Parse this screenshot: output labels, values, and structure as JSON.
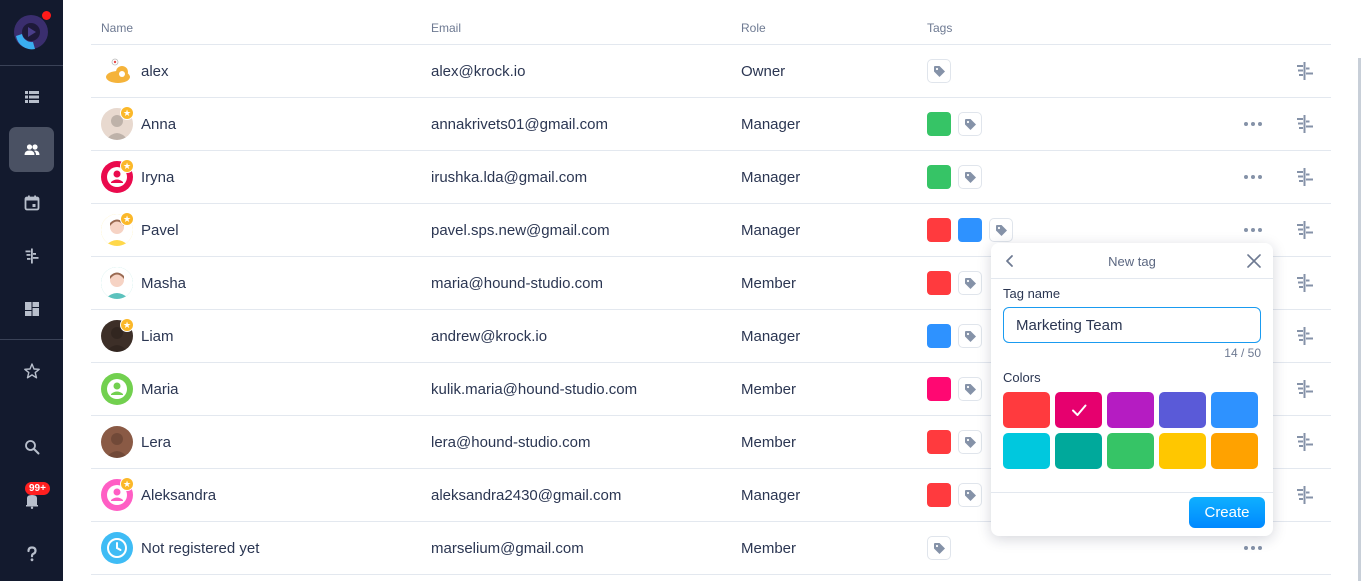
{
  "sidebar": {
    "items": [
      {
        "name": "list",
        "icon": "list-icon",
        "active": false
      },
      {
        "name": "team",
        "icon": "users-icon",
        "active": true
      },
      {
        "name": "calendar",
        "icon": "calendar-icon",
        "active": false
      },
      {
        "name": "timeline",
        "icon": "timeline-icon",
        "active": false
      },
      {
        "name": "dashboard",
        "icon": "dashboard-icon",
        "active": false
      },
      {
        "name": "favorites",
        "icon": "star-icon",
        "active": false
      },
      {
        "name": "search",
        "icon": "search-icon",
        "active": false
      },
      {
        "name": "notifications",
        "icon": "bell-icon",
        "active": false
      },
      {
        "name": "help",
        "icon": "help-icon",
        "active": false
      }
    ],
    "notification_badge": "99+"
  },
  "table": {
    "headers": {
      "name": "Name",
      "email": "Email",
      "role": "Role",
      "tags": "Tags"
    },
    "rows": [
      {
        "name": "alex",
        "email": "alex@krock.io",
        "role": "Owner",
        "tags": [],
        "star": false,
        "avatar": "dog-sticker",
        "avatar_color": "#f5b33a",
        "more": false
      },
      {
        "name": "Anna",
        "email": "annakrivets01@gmail.com",
        "role": "Manager",
        "tags": [
          "#36c466"
        ],
        "star": true,
        "avatar": "photo",
        "avatar_color": "#e8d9cf",
        "more": true
      },
      {
        "name": "Iryna",
        "email": "irushka.lda@gmail.com",
        "role": "Manager",
        "tags": [
          "#36c466"
        ],
        "star": true,
        "avatar": "default-user",
        "avatar_color": "#ea0a4d",
        "more": true
      },
      {
        "name": "Pavel",
        "email": "pavel.sps.new@gmail.com",
        "role": "Manager",
        "tags": [
          "#ff3a3e",
          "#2e92ff"
        ],
        "star": true,
        "avatar": "cartoon",
        "avatar_color": "#ffd84a",
        "more": true
      },
      {
        "name": "Masha",
        "email": "maria@hound-studio.com",
        "role": "Member",
        "tags": [
          "#ff3a3e"
        ],
        "star": false,
        "avatar": "cartoon",
        "avatar_color": "#5cc2bd",
        "more": false
      },
      {
        "name": "Liam",
        "email": "andrew@krock.io",
        "role": "Manager",
        "tags": [
          "#2e92ff"
        ],
        "star": true,
        "avatar": "photo",
        "avatar_color": "#3d2f28",
        "more": false
      },
      {
        "name": "Maria",
        "email": "kulik.maria@hound-studio.com",
        "role": "Member",
        "tags": [
          "#ff0872"
        ],
        "star": false,
        "avatar": "default-user",
        "avatar_color": "#72d04f",
        "more": false
      },
      {
        "name": "Lera",
        "email": "lera@hound-studio.com",
        "role": "Member",
        "tags": [
          "#ff3a3e"
        ],
        "star": false,
        "avatar": "photo",
        "avatar_color": "#8a5a45",
        "more": false
      },
      {
        "name": "Aleksandra",
        "email": "aleksandra2430@gmail.com",
        "role": "Manager",
        "tags": [
          "#ff3a3e"
        ],
        "star": true,
        "avatar": "default-user",
        "avatar_color": "#ff5ec4",
        "more": false
      },
      {
        "name": "Not registered yet",
        "email": "marselium@gmail.com",
        "role": "Member",
        "tags": [],
        "star": false,
        "avatar": "clock",
        "avatar_color": "#3fbcf5",
        "more": true
      }
    ]
  },
  "popover": {
    "title": "New tag",
    "field_label": "Tag name",
    "field_value": "Marketing Team",
    "counter": "14 / 50",
    "colors_label": "Colors",
    "colors": [
      "#ff3a3e",
      "#e6006e",
      "#b51cc2",
      "#5a5ad8",
      "#2e92ff",
      "#00c8de",
      "#00a99b",
      "#36c466",
      "#ffc700",
      "#ffa200"
    ],
    "selected_color_index": 1,
    "create_label": "Create"
  }
}
